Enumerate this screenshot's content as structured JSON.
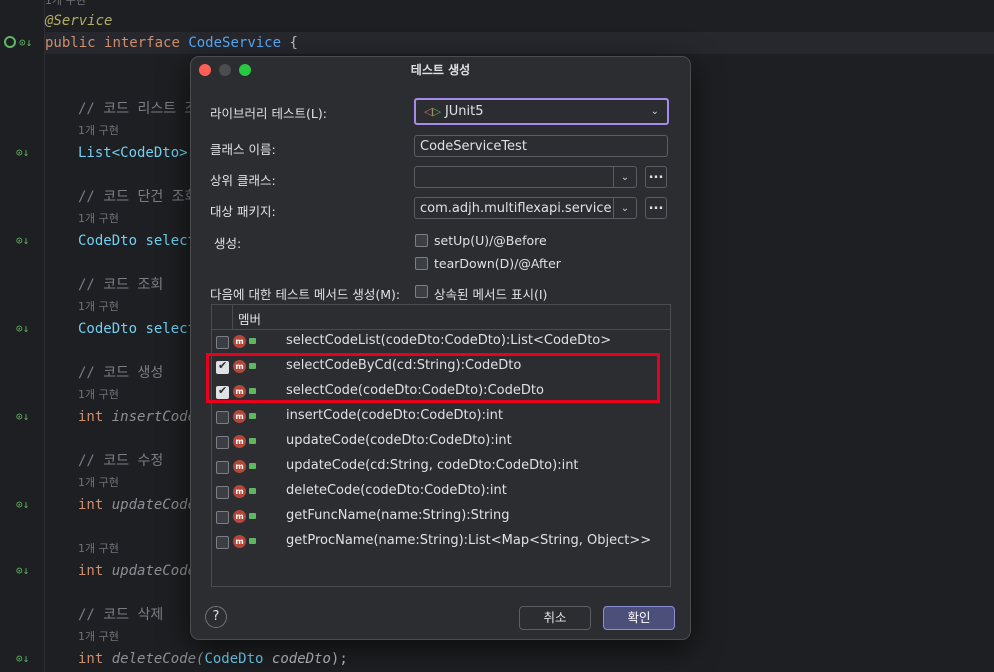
{
  "editor": {
    "top_hint": "1개 구현",
    "annotation": "@Service",
    "decl": {
      "kw1": "public",
      "kw2": "interface",
      "name": "CodeService",
      "brace": "{"
    },
    "comments": [
      "// 코드 리스트 조회",
      "// 코드 단건 조회",
      "// 코드 조회",
      "// 코드 생성",
      "// 코드 수정",
      "// 코드 삭제"
    ],
    "hint": "1개 구현",
    "lines": {
      "l1": {
        "type": "List<CodeDto>"
      },
      "l2": {
        "type": "CodeDto",
        "name": "select"
      },
      "l3": {
        "type": "CodeDto",
        "name": "select"
      },
      "l4": {
        "type": "int",
        "name": "insertCode"
      },
      "l5": {
        "type": "int",
        "name": "updateCode"
      },
      "l6": {
        "type": "int",
        "name": "updateCode"
      },
      "l7": {
        "type": "int",
        "name": "deleteCode(",
        "param_type": "CodeDto",
        "param": "codeDto",
        "end": ");"
      }
    }
  },
  "dialog": {
    "title": "테스트 생성",
    "library_label": "라이브러리 테스트(L):",
    "library_value": "JUnit5",
    "class_name_label": "클래스 이름:",
    "class_name_value": "CodeServiceTest",
    "superclass_label": "상위 클래스:",
    "superclass_value": "",
    "package_label": "대상 패키지:",
    "package_value": "com.adjh.multiflexapi.service",
    "dots": "...",
    "generate_label": "생성:",
    "setup_label": "setUp(U)/@Before",
    "teardown_label": "tearDown(D)/@After",
    "methods_label": "다음에 대한 테스트 메서드 생성(M):",
    "inherited_label": "상속된 메서드 표시(I)",
    "member_header": "멤버",
    "members": [
      {
        "sig": "selectCodeList(codeDto:CodeDto):List<CodeDto>",
        "checked": false
      },
      {
        "sig": "selectCodeByCd(cd:String):CodeDto",
        "checked": true
      },
      {
        "sig": "selectCode(codeDto:CodeDto):CodeDto",
        "checked": true
      },
      {
        "sig": "insertCode(codeDto:CodeDto):int",
        "checked": false
      },
      {
        "sig": "updateCode(codeDto:CodeDto):int",
        "checked": false
      },
      {
        "sig": "updateCode(cd:String, codeDto:CodeDto):int",
        "checked": false
      },
      {
        "sig": "deleteCode(codeDto:CodeDto):int",
        "checked": false
      },
      {
        "sig": "getFuncName(name:String):String",
        "checked": false
      },
      {
        "sig": "getProcName(name:String):List<Map<String, Object>>",
        "checked": false
      }
    ],
    "cancel": "취소",
    "ok": "확인",
    "help": "?"
  },
  "colors": {
    "accent": "#a68aed",
    "highlight": "#e8001d",
    "ok_button": "#4b4f7a"
  }
}
